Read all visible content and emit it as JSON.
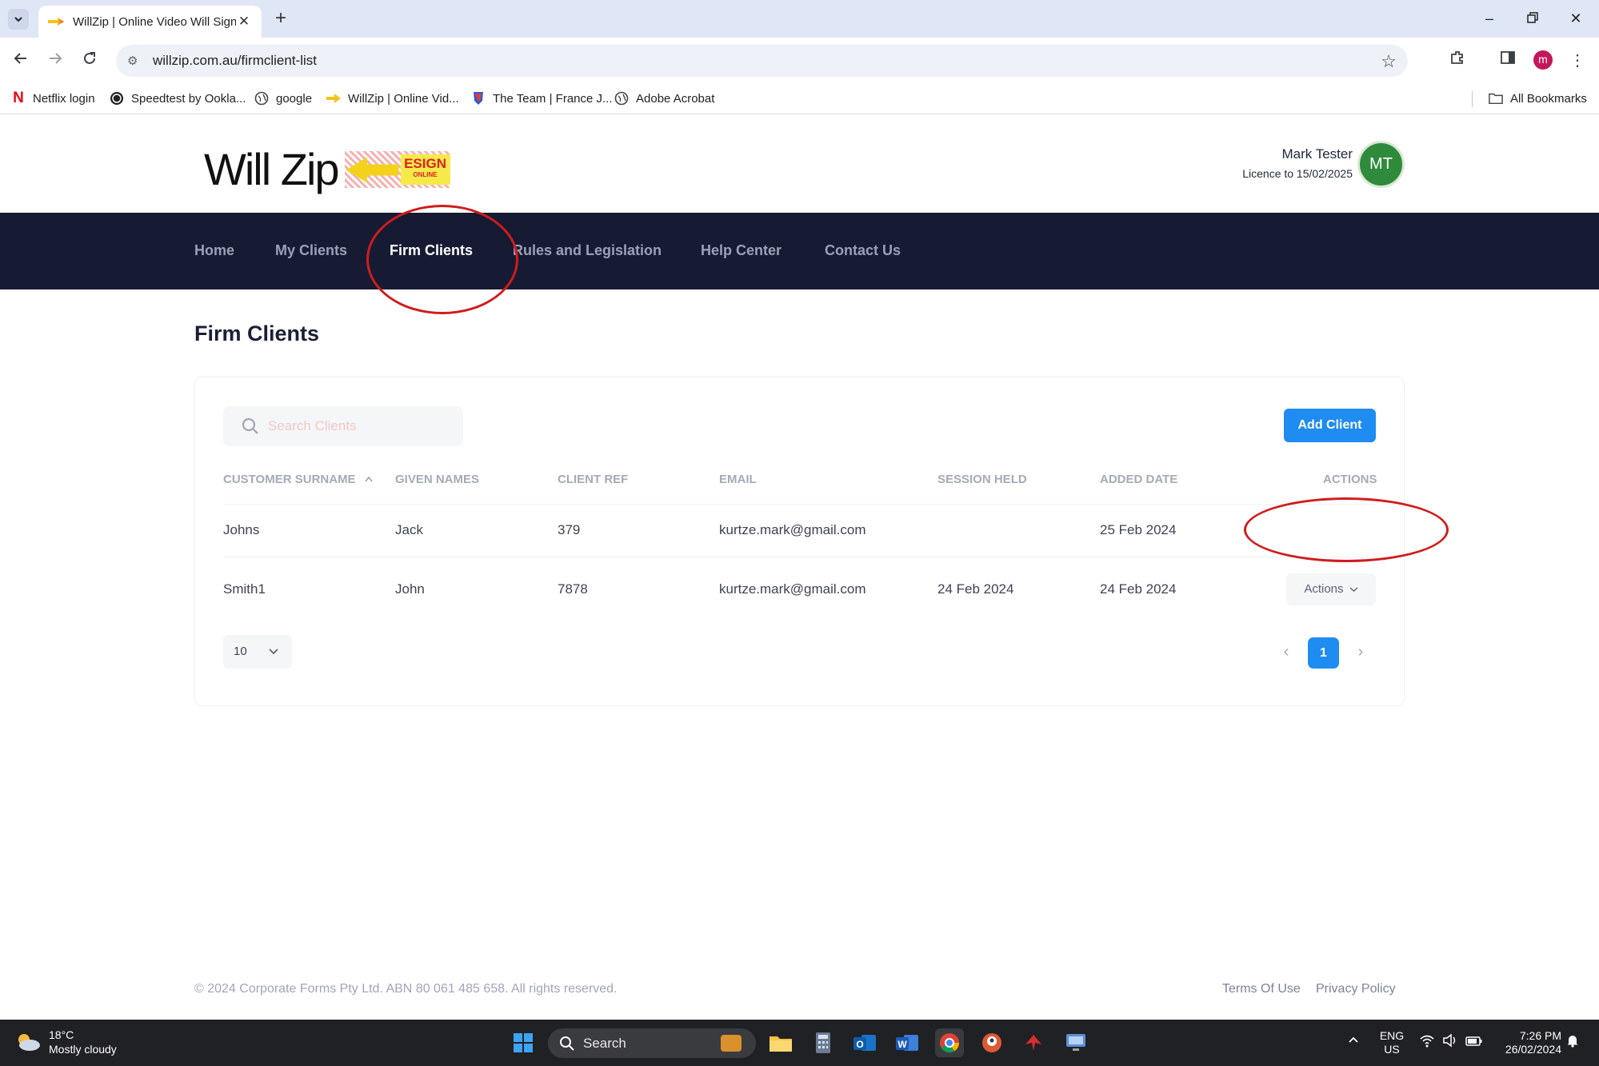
{
  "browser": {
    "tab_title": "WillZip | Online Video Will Sign",
    "url": "willzip.com.au/firmclient-list",
    "profile_initial": "m",
    "bookmarks": [
      {
        "label": "Netflix login",
        "icon": "netflix-icon"
      },
      {
        "label": "Speedtest by Ookla...",
        "icon": "speedtest-icon"
      },
      {
        "label": "google",
        "icon": "globe-icon"
      },
      {
        "label": "WillZip | Online Vid...",
        "icon": "willzip-icon"
      },
      {
        "label": "The Team | France J...",
        "icon": "team-icon"
      },
      {
        "label": "Adobe Acrobat",
        "icon": "globe-icon"
      }
    ],
    "all_bookmarks_label": "All Bookmarks"
  },
  "header": {
    "logo_text": "Will Zip",
    "logo_badge": "ESIGN",
    "logo_badge_sub": "ONLINE",
    "user_name": "Mark Tester",
    "licence": "Licence to 15/02/2025",
    "avatar_initials": "MT"
  },
  "nav": {
    "items": [
      {
        "label": "Home",
        "active": false
      },
      {
        "label": "My Clients",
        "active": false
      },
      {
        "label": "Firm Clients",
        "active": true
      },
      {
        "label": "Rules and Legislation",
        "active": false
      },
      {
        "label": "Help Center",
        "active": false
      },
      {
        "label": "Contact Us",
        "active": false
      }
    ]
  },
  "page": {
    "title": "Firm Clients",
    "search_placeholder": "Search Clients",
    "add_button": "Add Client"
  },
  "table": {
    "columns": [
      "CUSTOMER SURNAME",
      "GIVEN NAMES",
      "CLIENT REF",
      "EMAIL",
      "SESSION HELD",
      "ADDED DATE",
      "ACTIONS"
    ],
    "rows": [
      {
        "surname": "Johns",
        "given": "Jack",
        "ref": "379",
        "email": "kurtze.mark@gmail.com",
        "session": "",
        "added": "25 Feb 2024",
        "actions": ""
      },
      {
        "surname": "Smith1",
        "given": "John",
        "ref": "7878",
        "email": "kurtze.mark@gmail.com",
        "session": "24 Feb 2024",
        "added": "24 Feb 2024",
        "actions": "Actions"
      }
    ],
    "page_size": "10",
    "current_page": "1"
  },
  "footer": {
    "copyright": "© 2024 Corporate Forms Pty Ltd. ABN 80 061 485 658. All rights reserved.",
    "terms": "Terms Of Use",
    "privacy": "Privacy Policy"
  },
  "taskbar": {
    "temperature": "18°C",
    "weather": "Mostly cloudy",
    "search_label": "Search",
    "lang_top": "ENG",
    "lang_bottom": "US",
    "time": "7:26 PM",
    "date": "26/02/2024"
  },
  "colors": {
    "nav_bg": "#161b33",
    "primary": "#1e8cf0",
    "avatar": "#2f8a3c",
    "annotation": "#d01c1c"
  }
}
